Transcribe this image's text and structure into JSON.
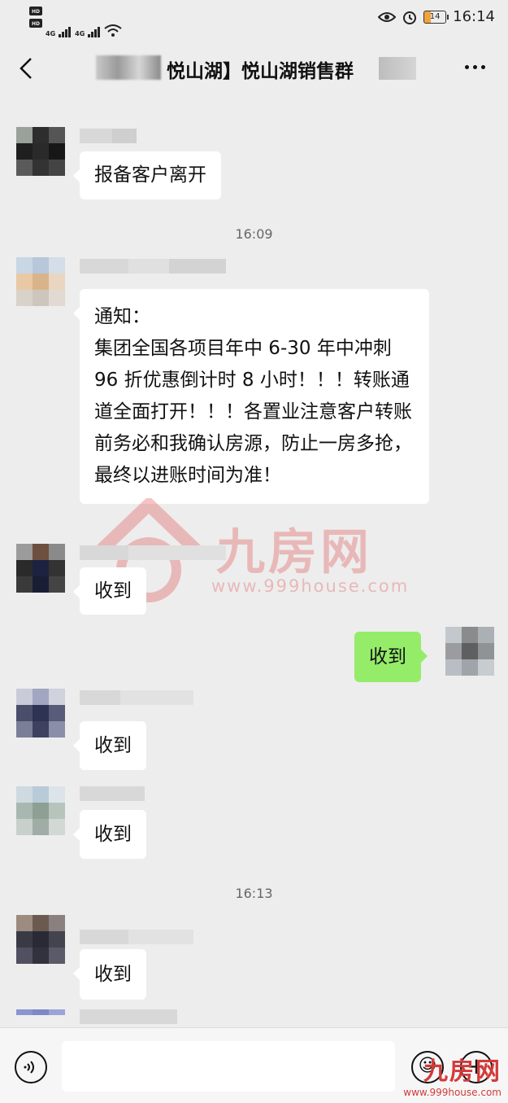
{
  "status_bar": {
    "hd1": "HD 1",
    "hd2": "HD 2",
    "net1": "4G",
    "net2": "4G",
    "battery": "14",
    "time": "16:14"
  },
  "header": {
    "title": "悦山湖】悦山湖销售群"
  },
  "messages": {
    "m1": "报备客户离开",
    "t1": "16:09",
    "m2": "通知：\n集团全国各项目年中 6-30 年中冲刺 96 折优惠倒计时 8 小时！！！转账通道全面打开！！！各置业注意客户转账前务必和我确认房源，防止一房多抢，最终以进账时间为准！",
    "m3": "收到",
    "m4": "收到",
    "m5": "收到",
    "m6": "收到",
    "t2": "16:13",
    "m7": "收到"
  },
  "watermark": {
    "brand": "九房网",
    "url": "www.999house.com"
  },
  "corner_watermark": {
    "brand": "九房网",
    "url": "www.999house.com"
  },
  "icons": {
    "back": "chevron-left-icon",
    "more": "more-icon",
    "voice": "voice-icon",
    "emoji": "emoji-icon",
    "add": "add-icon"
  },
  "colors": {
    "background": "#ededed",
    "bubble_self": "#95ec69",
    "bubble_other": "#ffffff"
  }
}
